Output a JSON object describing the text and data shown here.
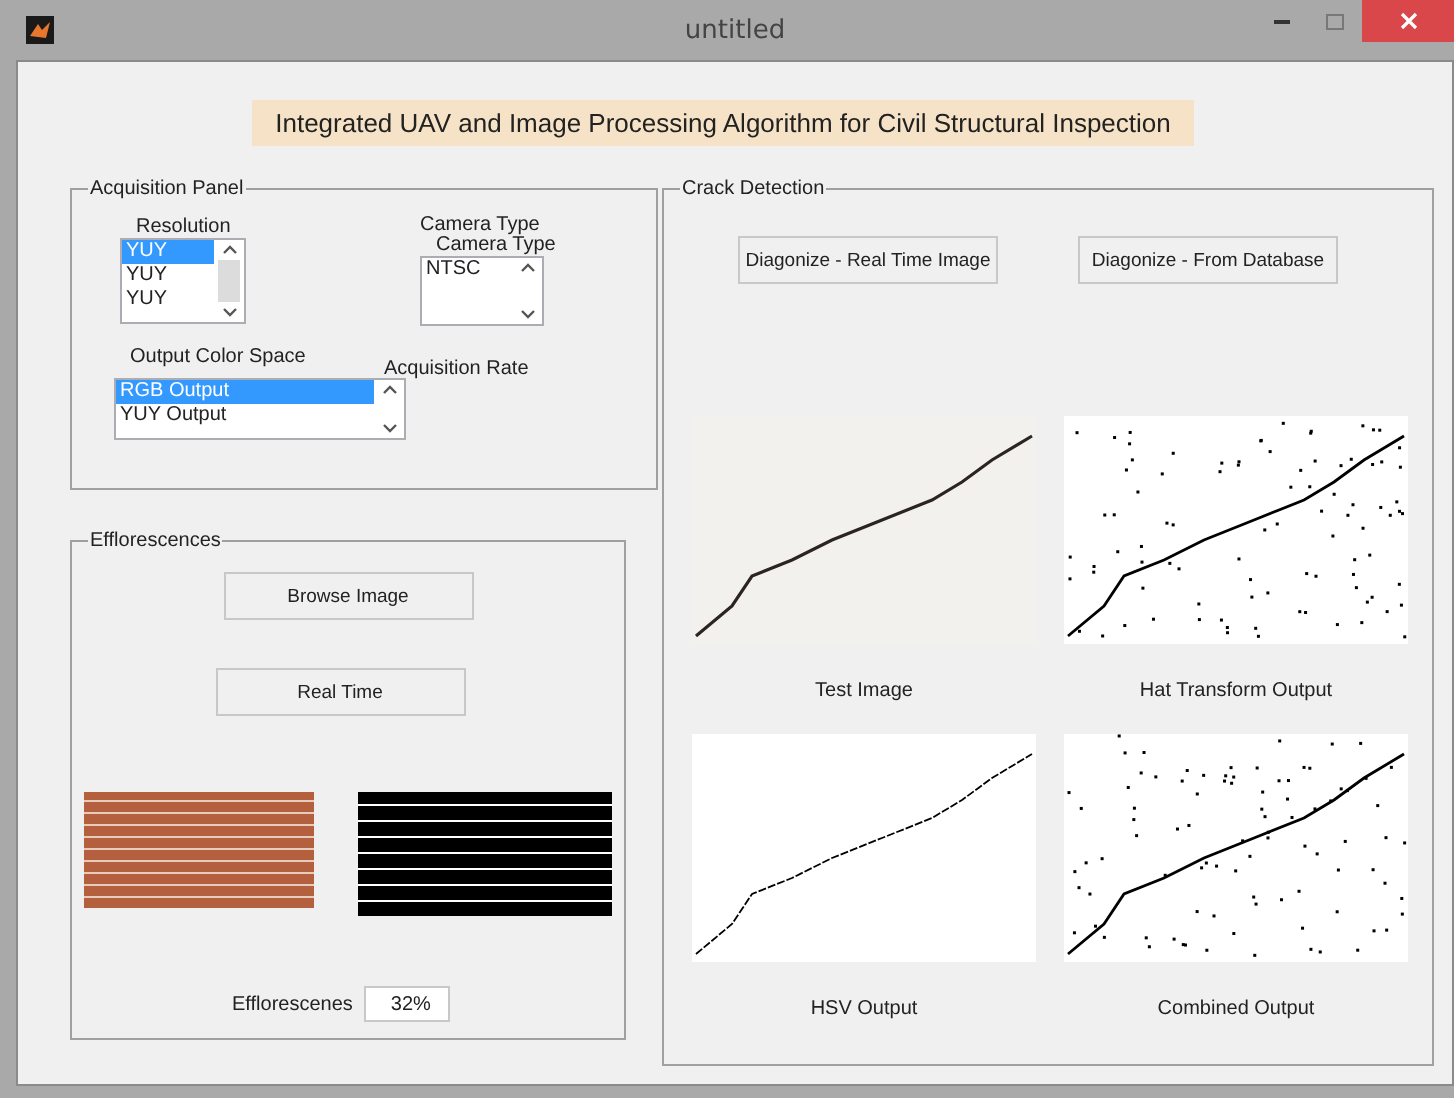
{
  "window": {
    "title": "untitled"
  },
  "banner": "Integrated UAV and Image Processing Algorithm for Civil Structural Inspection",
  "acquisition_panel": {
    "title": "Acquisition Panel",
    "resolution": {
      "label": "Resolution",
      "items": [
        {
          "label": "YUY",
          "selected": true
        },
        {
          "label": "YUY",
          "selected": false
        },
        {
          "label": "YUY",
          "selected": false
        }
      ]
    },
    "camera_type": {
      "label": "Camera Type",
      "overlay_label": "Camera Type",
      "items": [
        {
          "label": "NTSC",
          "selected": false
        }
      ]
    },
    "output_color_space": {
      "label": "Output Color Space",
      "items": [
        {
          "label": "RGB Output",
          "selected": true
        },
        {
          "label": "YUY Output",
          "selected": false
        }
      ]
    },
    "acquisition_rate_label": "Acquisition Rate"
  },
  "efflorescences_panel": {
    "title": "Efflorescences",
    "buttons": [
      "Browse Image",
      "Real Time"
    ],
    "images": [
      {
        "kind": "photo"
      },
      {
        "kind": "binary"
      }
    ],
    "result_label": "Efflorescenes",
    "result_value": "32%"
  },
  "crack_detection_panel": {
    "title": "Crack Detection",
    "buttons": [
      "Diagonize - Real Time Image",
      "Diagonize - From Database"
    ],
    "outputs": [
      {
        "kind": "photo",
        "caption": "Test Image"
      },
      {
        "kind": "noisy",
        "caption": "Hat Transform Output"
      },
      {
        "kind": "clean",
        "caption": "HSV Output"
      },
      {
        "kind": "noisy",
        "caption": "Combined Output"
      }
    ]
  }
}
